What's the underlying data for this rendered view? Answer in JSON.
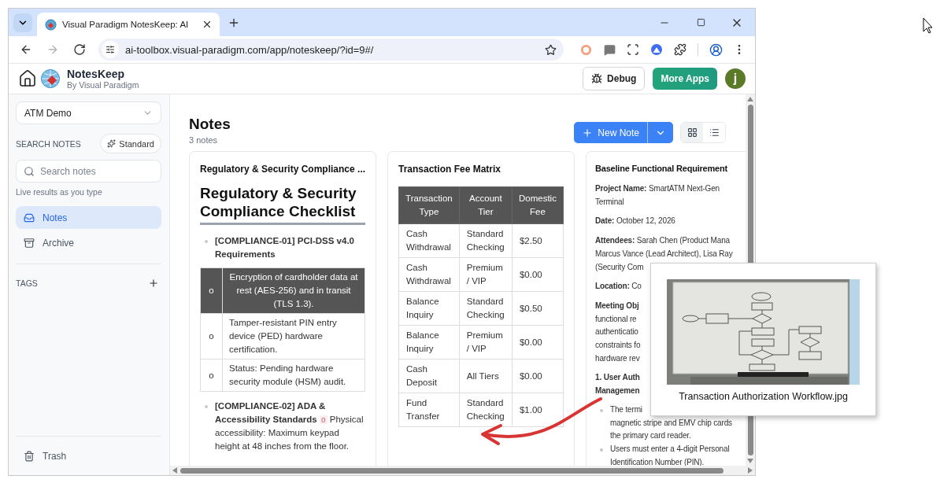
{
  "browser": {
    "tab": {
      "title": "Visual Paradigm NotesKeep: AI"
    },
    "nav_buttons": [
      {
        "kind": "back",
        "disabled": false
      },
      {
        "kind": "forward",
        "disabled": true
      },
      {
        "kind": "reload",
        "disabled": false
      }
    ],
    "address": "ai-toolbox.visual-paradigm.com/app/noteskeep/?id=9#/"
  },
  "app_header": {
    "name": "NotesKeep",
    "byline": "By Visual Paradigm",
    "debug_button": "Debug",
    "more_apps_button": "More Apps",
    "avatar": "j"
  },
  "sidebar": {
    "notebook": "ATM Demo",
    "search_label": "SEARCH NOTES",
    "mode_button": "Standard",
    "search_placeholder": "Search notes",
    "search_hint": "Live results as you type",
    "nav": [
      {
        "kind": "notes",
        "label": "Notes",
        "selected": true
      },
      {
        "kind": "archive",
        "label": "Archive",
        "selected": false
      }
    ],
    "tags_label": "TAGS",
    "trash": "Trash"
  },
  "main": {
    "title": "Notes",
    "count": "3 notes",
    "new_note_button": "New Note",
    "view_modes": [
      {
        "kind": "grid",
        "selected": true
      },
      {
        "kind": "list",
        "selected": false
      }
    ]
  },
  "notes": [
    {
      "kind": "checklist",
      "title": "Regulatory & Security Compliance ...",
      "heading": "Regulatory & Security Compliance Checklist",
      "items": [
        {
          "title": "[COMPLIANCE-01] PCI-DSS v4.0 Requirements",
          "rows": [
            {
              "marker": "o",
              "text": "Encryption of cardholder data at rest (AES-256) and in transit (TLS 1.3).",
              "header": true
            },
            {
              "marker": "o",
              "text": "Tamper-resistant PIN entry device (PED) hardware certification.",
              "header": false
            },
            {
              "marker": "o",
              "text": "Status: Pending hardware security module (HSM) audit.",
              "header": false
            }
          ]
        },
        {
          "title": "[COMPLIANCE-02] ADA & Accessibility Standards",
          "marker": "o",
          "text": "Physical accessibility: Maximum keypad height at 48 inches from the floor."
        }
      ]
    },
    {
      "kind": "table",
      "title": "Transaction Fee Matrix",
      "columns": [
        "Transaction Type",
        "Account Tier",
        "Domestic Fee"
      ],
      "rows": [
        [
          "Cash Withdrawal",
          "Standard Checking",
          "$2.50"
        ],
        [
          "Cash Withdrawal",
          "Premium / VIP",
          "$0.00"
        ],
        [
          "Balance Inquiry",
          "Standard Checking",
          "$0.50"
        ],
        [
          "Balance Inquiry",
          "Premium / VIP",
          "$0.00"
        ],
        [
          "Cash Deposit",
          "All Tiers",
          "$0.00"
        ],
        [
          "Fund Transfer",
          "Standard Checking",
          "$1.00"
        ]
      ]
    },
    {
      "kind": "minutes",
      "title": "Baseline Functional Requirement",
      "blocks": [
        {
          "kind": "paragraph",
          "lines": [
            "**Project Name:** SmartATM Next-Gen",
            "Terminal"
          ]
        },
        {
          "kind": "paragraph",
          "lines": [
            "**Date:** October 12, 2026"
          ]
        },
        {
          "kind": "paragraph",
          "lines": [
            "**Attendees:** Sarah Chen (Product Mana",
            "Marcus Vance (Lead Architect), Lisa Ray",
            "(Security Com"
          ]
        },
        {
          "kind": "paragraph",
          "lines": [
            "**Location:** Co"
          ]
        },
        {
          "kind": "paragraph",
          "lines": [
            "**Meeting Obj**",
            "functional re",
            "authenticatio",
            "constraints fo",
            "hardware rev"
          ]
        },
        {
          "kind": "heading",
          "lines": [
            "1. User Auth",
            "Managemen"
          ]
        },
        {
          "kind": "bullet",
          "lines": [
            "The termi",
            "magnetic stripe and EMV chip cards",
            "the primary card reader."
          ]
        },
        {
          "kind": "bullet",
          "lines": [
            "Users must enter a 4-digit Personal",
            "Identification Number (PIN)."
          ]
        }
      ]
    }
  ],
  "drag_preview": {
    "caption": "Transaction Authorization Workflow.jpg"
  }
}
